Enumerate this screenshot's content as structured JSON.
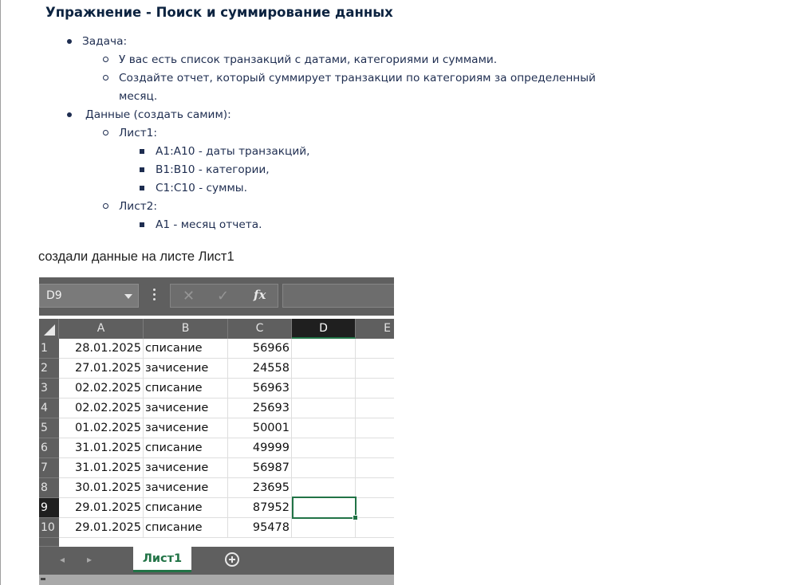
{
  "document": {
    "title": "Упражнение - Поиск и суммирование данных",
    "task_label": "Задача:",
    "task_items": [
      "У вас есть список транзакций с датами, категориями и суммами.",
      "Создайте отчет, который суммирует транзакции по категориям за определенный",
      "месяц."
    ],
    "data_label": "Данные (создать самим):",
    "sheet1_label": "Лист1:",
    "sheet1_items": [
      "A1:A10 - даты транзакций,",
      "B1:B10 - категории,",
      "C1:C10 - суммы."
    ],
    "sheet2_label": "Лист2:",
    "sheet2_items": [
      "A1 -  месяц отчета."
    ]
  },
  "caption": "создали данные на листе Лист1",
  "excel": {
    "name_box": "D9",
    "formula_cancel_icon": "cancel-x-icon",
    "formula_enter_icon": "checkmark-icon",
    "fx_label": "fx",
    "columns": [
      "A",
      "B",
      "C",
      "D",
      "E"
    ],
    "selected_column": "D",
    "selected_row": "9",
    "rows": [
      {
        "num": "1",
        "date": "28.01.2025",
        "category": "списание",
        "amount": "56966"
      },
      {
        "num": "2",
        "date": "27.01.2025",
        "category": "зачисение",
        "amount": "24558"
      },
      {
        "num": "3",
        "date": "02.02.2025",
        "category": "списание",
        "amount": "56963"
      },
      {
        "num": "4",
        "date": "02.02.2025",
        "category": "зачисение",
        "amount": "25693"
      },
      {
        "num": "5",
        "date": "01.02.2025",
        "category": "зачисение",
        "amount": "50001"
      },
      {
        "num": "6",
        "date": "31.01.2025",
        "category": "списание",
        "amount": "49999"
      },
      {
        "num": "7",
        "date": "31.01.2025",
        "category": "зачисение",
        "amount": "56987"
      },
      {
        "num": "8",
        "date": "30.01.2025",
        "category": "зачисение",
        "amount": "23695"
      },
      {
        "num": "9",
        "date": "29.01.2025",
        "category": "списание",
        "amount": "87952"
      },
      {
        "num": "10",
        "date": "29.01.2025",
        "category": "списание",
        "amount": "95478"
      }
    ],
    "sheet_tab": "Лист1",
    "colors": {
      "accent": "#217346",
      "chrome": "#5f5f5f"
    }
  }
}
